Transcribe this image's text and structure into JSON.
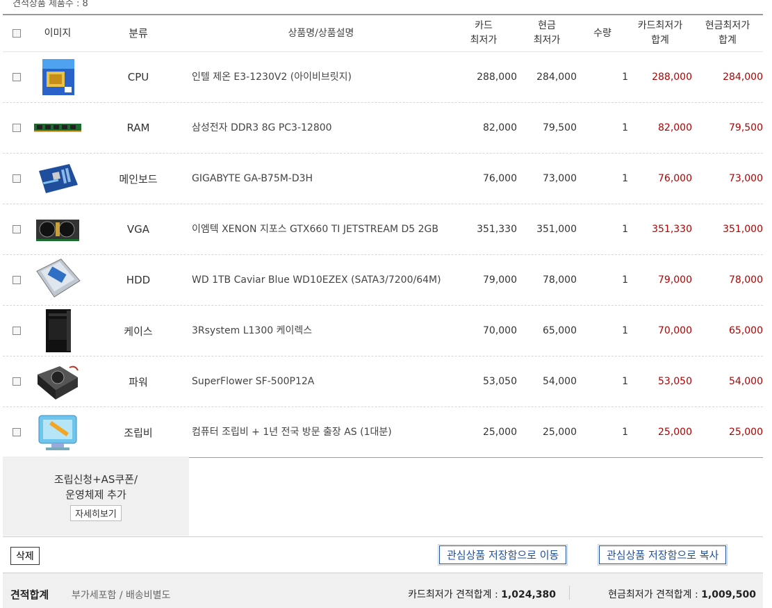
{
  "top_label": "견적상품 제품수 : 8",
  "header": {
    "image": "이미지",
    "category": "분류",
    "name": "상품명/상품설명",
    "card_line1": "카드",
    "card_line2": "최저가",
    "cash_line1": "현금",
    "cash_line2": "최저가",
    "qty": "수량",
    "card_sum_line1": "카드최저가",
    "card_sum_line2": "합계",
    "cash_sum_line1": "현금최저가",
    "cash_sum_line2": "합계"
  },
  "rows": [
    {
      "icon": "cpu-box-icon",
      "category": "CPU",
      "name": "인텔 제온 E3-1230V2 (아이비브릿지)",
      "card": "288,000",
      "cash": "284,000",
      "qty": "1",
      "card_sum": "288,000",
      "cash_sum": "284,000"
    },
    {
      "icon": "ram-stick-icon",
      "category": "RAM",
      "name": "삼성전자 DDR3 8G PC3-12800",
      "card": "82,000",
      "cash": "79,500",
      "qty": "1",
      "card_sum": "82,000",
      "cash_sum": "79,500"
    },
    {
      "icon": "mainboard-icon",
      "category": "메인보드",
      "name": "GIGABYTE GA-B75M-D3H",
      "card": "76,000",
      "cash": "73,000",
      "qty": "1",
      "card_sum": "76,000",
      "cash_sum": "73,000"
    },
    {
      "icon": "graphics-card-icon",
      "category": "VGA",
      "name": "이엠텍 XENON 지포스 GTX660 TI JETSTREAM D5 2GB",
      "card": "351,330",
      "cash": "351,000",
      "qty": "1",
      "card_sum": "351,330",
      "cash_sum": "351,000"
    },
    {
      "icon": "hard-drive-icon",
      "category": "HDD",
      "name": "WD 1TB Caviar Blue WD10EZEX (SATA3/7200/64M)",
      "card": "79,000",
      "cash": "78,000",
      "qty": "1",
      "card_sum": "79,000",
      "cash_sum": "78,000"
    },
    {
      "icon": "pc-case-icon",
      "category": "케이스",
      "name": "3Rsystem L1300 케이렉스",
      "card": "70,000",
      "cash": "65,000",
      "qty": "1",
      "card_sum": "70,000",
      "cash_sum": "65,000"
    },
    {
      "icon": "power-supply-icon",
      "category": "파워",
      "name": "SuperFlower SF-500P12A",
      "card": "53,050",
      "cash": "54,000",
      "qty": "1",
      "card_sum": "53,050",
      "cash_sum": "54,000"
    },
    {
      "icon": "assembly-wrench-icon",
      "category": "조립비",
      "name": "컴퓨터 조립비 + 1년 전국 방문 출장 AS (1대분)",
      "card": "25,000",
      "cash": "25,000",
      "qty": "1",
      "card_sum": "25,000",
      "cash_sum": "25,000"
    }
  ],
  "option_box": {
    "line1": "조립신청+AS쿠폰/",
    "line2": "운영체제 추가",
    "detail_button": "자세히보기"
  },
  "actions": {
    "delete": "삭제",
    "move": "관심상품 저장함으로 이동",
    "copy": "관심상품 저장함으로 복사"
  },
  "footer": {
    "title": "견적합계",
    "note": "부가세포함 / 배송비별도",
    "card_total_label": "카드최저가 견적합계 : ",
    "card_total": "1,024,380",
    "cash_total_label": "현금최저가 견적합계 : ",
    "cash_total": "1,009,500"
  },
  "colors": {
    "price_red": "#b30000",
    "button_blue": "#1d4fa3"
  }
}
